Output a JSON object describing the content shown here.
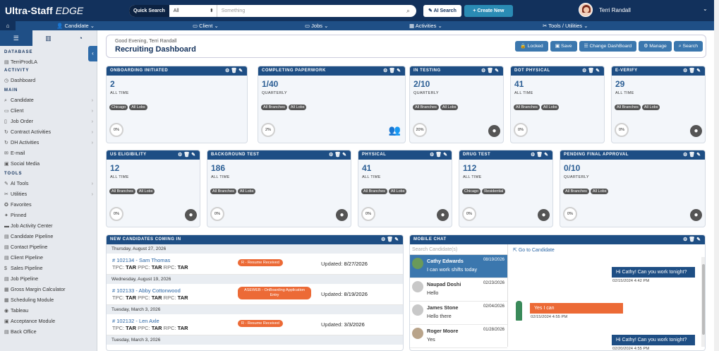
{
  "app": {
    "brand": "Ultra-Staff",
    "edition": "EDGE"
  },
  "search": {
    "label": "Quick Search",
    "scope": "All",
    "placeholder": "Something"
  },
  "topbar": {
    "ai_search": "AI Search",
    "create_new": "Create New",
    "user_name": "Terri Randall"
  },
  "nav": [
    "Candidate",
    "Client",
    "Jobs",
    "Activities",
    "Tools / Utilities"
  ],
  "sidebar": {
    "database_heading": "DATABASE",
    "database": "TerriProdLA",
    "activity_heading": "ACTIVITY",
    "activity": [
      "Dashboard"
    ],
    "main_heading": "MAIN",
    "main": [
      "Candidate",
      "Client",
      "Job Order",
      "Contract Activities",
      "DH Activities",
      "E-mail",
      "Social Media"
    ],
    "tools_heading": "TOOLS",
    "tools": [
      "AI Tools",
      "Utilities",
      "Favorites",
      "Pinned",
      "Job Activity Center",
      "Candidate Pipeline",
      "Contact Pipeline",
      "Client Pipeline",
      "Sales Pipeline",
      "Job Pipeline",
      "Gross Margin Calculator",
      "Scheduling Module",
      "Tableau",
      "Acceptance Module",
      "Back Office"
    ]
  },
  "header": {
    "greeting": "Good Evening, Terri Randall",
    "title": "Recruiting Dashboard",
    "buttons": [
      "Locked",
      "Save",
      "Change DashBoard",
      "Manage",
      "Search"
    ]
  },
  "cards": [
    {
      "title": "ONBOARDING INITIATED",
      "value": "2",
      "period": "ALL TIME",
      "tags": [
        "Chicago",
        "All Lobs"
      ],
      "pct": "0%",
      "icon": "none"
    },
    {
      "title": "COMPLETING PAPERWORK",
      "value": "1/40",
      "period": "QUARTERLY",
      "tags": [
        "All Branches",
        "All Lobs"
      ],
      "pct": "2%",
      "icon": "group"
    },
    {
      "title": "IN TESTING",
      "value": "2/10",
      "period": "QUARTERLY",
      "tags": [
        "All Branches",
        "All Lobs"
      ],
      "pct": "20%",
      "icon": "user"
    },
    {
      "title": "DOT PHYSICAL",
      "value": "41",
      "period": "ALL TIME",
      "tags": [
        "All Branches",
        "All Lobs"
      ],
      "pct": "0%",
      "icon": "none"
    },
    {
      "title": "E-VERIFY",
      "value": "29",
      "period": "ALL TIME",
      "tags": [
        "All Branches",
        "All Lobs"
      ],
      "pct": "0%",
      "icon": "user"
    },
    {
      "title": "US ELIGIBILITY",
      "value": "12",
      "period": "ALL TIME",
      "tags": [
        "All Branches",
        "All Lobs"
      ],
      "pct": "0%",
      "icon": "user"
    },
    {
      "title": "BACKGROUND TEST",
      "value": "186",
      "period": "ALL TIME",
      "tags": [
        "All Branches",
        "All Lobs"
      ],
      "pct": "0%",
      "icon": "user"
    },
    {
      "title": "PHYSICAL",
      "value": "41",
      "period": "ALL TIME",
      "tags": [
        "All Branches",
        "All Lobs"
      ],
      "pct": "0%",
      "icon": "user"
    },
    {
      "title": "DRUG TEST",
      "value": "112",
      "period": "ALL TIME",
      "tags": [
        "Chicago",
        "Residential"
      ],
      "pct": "0%",
      "icon": "user"
    },
    {
      "title": "PENDING FINAL APPROVAL",
      "value": "0/10",
      "period": "QUARTERLY",
      "tags": [
        "All Branches",
        "All Lobs"
      ],
      "pct": "0%",
      "icon": "user"
    }
  ],
  "new_candidates": {
    "title": "NEW CANDIDATES COMING IN",
    "rows": [
      {
        "date": "Thursday, August 27, 2026",
        "name": "# 102134 - Sam Thomas",
        "status": "R - Resume Received",
        "updated_label": "Updated:",
        "updated": "8/27/2026"
      },
      {
        "date": "Wednesday, August 19, 2026",
        "name": "# 102133 - Abby Cottonwood",
        "status": "ASEWEB - OnBoarding Application Entry",
        "updated_label": "Updated:",
        "updated": "8/19/2026"
      },
      {
        "date": "Tuesday, March 3, 2026",
        "name": "# 102132 - Len Axle",
        "status": "R - Resume Received",
        "updated_label": "Updated:",
        "updated": "3/3/2026"
      }
    ],
    "last_date": "Tuesday, March 3, 2026",
    "tpc": [
      "TPC:",
      "TAR",
      "PPC:",
      "TAR",
      "RPC:",
      "TAR"
    ]
  },
  "chat": {
    "title": "MOBILE CHAT",
    "search_placeholder": "Search Candidate(s)",
    "goto": "Go to Candidate",
    "contacts": [
      {
        "name": "Cathy Edwards",
        "date": "08/19/2026",
        "msg": "I can work shifts today"
      },
      {
        "name": "Naupad Doshi",
        "date": "02/23/2026",
        "msg": "Hello"
      },
      {
        "name": "James Stone",
        "date": "02/04/2026",
        "msg": "Hello there"
      },
      {
        "name": "Roger Moore",
        "date": "01/28/2026",
        "msg": "Yes"
      }
    ],
    "messages": [
      {
        "text": "Hi Cathy! Can you work tonight?",
        "time": "02/15/2024 4:42 PM",
        "dir": "in"
      },
      {
        "text": "Yes I can",
        "time": "02/15/2024 4:55 PM",
        "dir": "out"
      },
      {
        "text": "Hi Cathy! Can you work tonight?",
        "time": "02/20/2024 4:55 PM",
        "dir": "in"
      }
    ]
  }
}
